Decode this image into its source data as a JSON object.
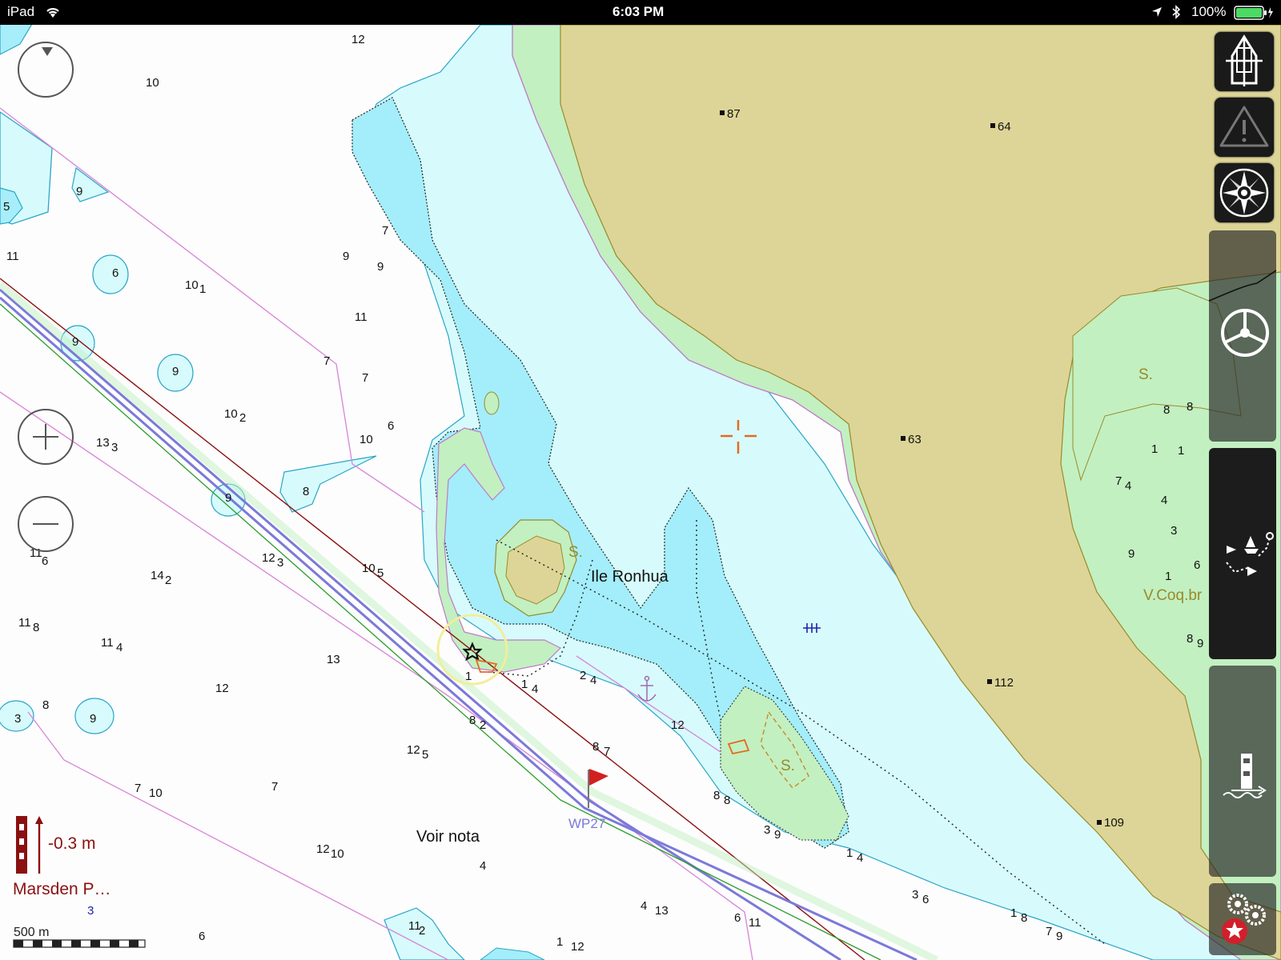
{
  "status_bar": {
    "device": "iPad",
    "time": "6:03 PM",
    "battery": "100%"
  },
  "map": {
    "place_name": "Ile Ronhua",
    "note_label": "Voir nota",
    "waypoint_label": "WP27",
    "shoal_label": "S.",
    "marker_label": "V.Coq.br",
    "heights": [
      "87",
      "64",
      "63",
      "112",
      "109"
    ],
    "soundings": [
      "12",
      "10",
      "9",
      "5",
      "11",
      "7",
      "9",
      "10",
      "1",
      "9",
      "6",
      "11",
      "9",
      "7",
      "10",
      "2",
      "9",
      "13",
      "3",
      "7",
      "6",
      "8",
      "10",
      "9",
      "11",
      "6",
      "12",
      "3",
      "14",
      "2",
      "10",
      "5",
      "11",
      "8",
      "11",
      "4",
      "13",
      "12",
      "8",
      "3",
      "8",
      "2",
      "12",
      "5",
      "9",
      "7",
      "10",
      "7",
      "12",
      "10",
      "4",
      "12",
      "8",
      "7",
      "1",
      "4",
      "2",
      "4",
      "1",
      "8",
      "8",
      "3",
      "9",
      "1",
      "4",
      "3",
      "6",
      "4",
      "13",
      "6",
      "11",
      "1",
      "8",
      "7",
      "9",
      "1",
      "12",
      "6",
      "11",
      "2",
      "8",
      "1",
      "7",
      "4",
      "4",
      "9",
      "3",
      "1",
      "6",
      "8",
      "9",
      "10",
      "9",
      "6",
      "2",
      "8",
      "4",
      "7"
    ]
  },
  "tide": {
    "value": "-0.3 m",
    "station": "Marsden P…",
    "count": "3"
  },
  "scale": {
    "label": "500 m"
  },
  "controls": {
    "zoom_in": "zoom-in",
    "zoom_out": "zoom-out",
    "rotate": "rotate"
  },
  "sidebar": [
    "boat-icon",
    "warning-icon",
    "compass-rose-icon",
    "helm-icon",
    "route-icon",
    "lighthouse-icon",
    "settings-icon"
  ]
}
